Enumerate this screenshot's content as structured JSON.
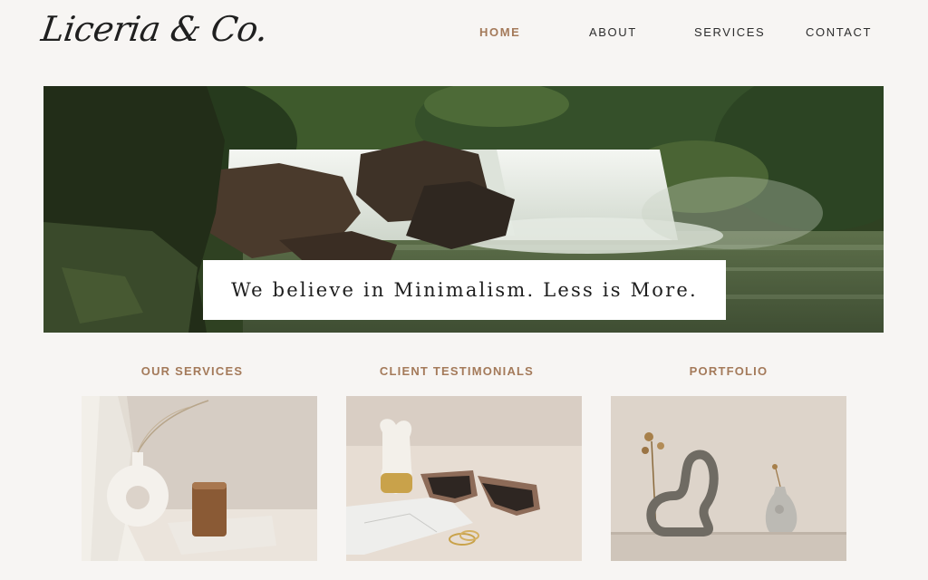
{
  "brand": {
    "logo_text": "Liceria & Co."
  },
  "nav": {
    "items": [
      {
        "label": "HOME",
        "active": true
      },
      {
        "label": "ABOUT",
        "active": false
      },
      {
        "label": "SERVICES",
        "active": false
      },
      {
        "label": "CONTACT",
        "active": false
      }
    ]
  },
  "hero": {
    "tagline": "We believe in Minimalism. Less is More.",
    "image_subject": "waterfall-forest-photo"
  },
  "sections": [
    {
      "title": "OUR SERVICES",
      "image_subject": "vase-candle-still-life-photo"
    },
    {
      "title": "CLIENT TESTIMONIALS",
      "image_subject": "sunglasses-marble-still-life-photo"
    },
    {
      "title": "PORTFOLIO",
      "image_subject": "sculpture-vases-shelf-photo"
    }
  ],
  "colors": {
    "background": "#f7f5f3",
    "accent": "#a47a5a",
    "text": "#2b2b2b"
  }
}
